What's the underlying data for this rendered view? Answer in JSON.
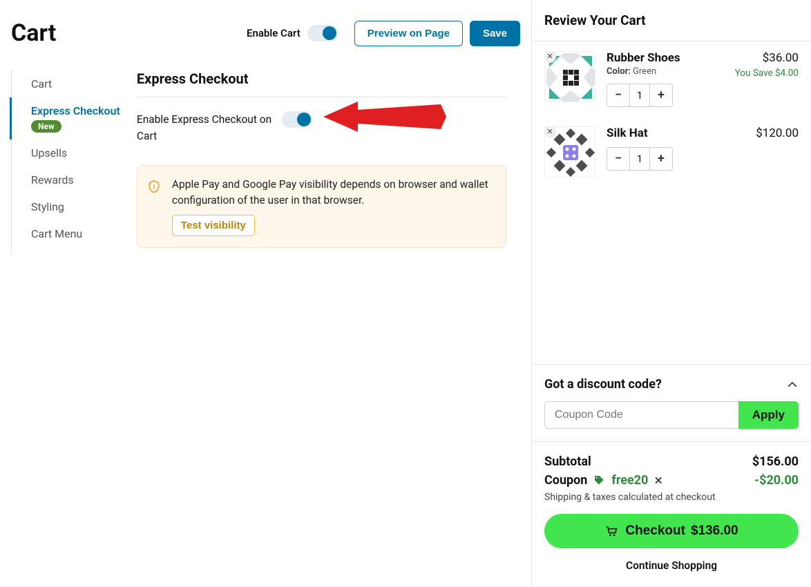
{
  "header": {
    "title": "Cart",
    "enable_label": "Enable Cart",
    "preview_label": "Preview on Page",
    "save_label": "Save"
  },
  "sidebar": {
    "items": [
      {
        "label": "Cart"
      },
      {
        "label": "Express Checkout",
        "badge": "New"
      },
      {
        "label": "Upsells"
      },
      {
        "label": "Rewards"
      },
      {
        "label": "Styling"
      },
      {
        "label": "Cart Menu"
      }
    ]
  },
  "section": {
    "title": "Express Checkout",
    "setting_label": "Enable Express Checkout on Cart",
    "callout_msg": "Apple Pay and Google Pay visibility depends on browser and wallet configuration of the user in that browser.",
    "test_label": "Test visibility"
  },
  "cart": {
    "review_title": "Review Your Cart",
    "items": [
      {
        "name": "Rubber Shoes",
        "meta_key": "Color:",
        "meta_val": "Green",
        "price": "$36.00",
        "save": "You Save $4.00",
        "qty": "1"
      },
      {
        "name": "Silk Hat",
        "price": "$120.00",
        "qty": "1"
      }
    ],
    "discount_title": "Got a discount code?",
    "coupon_placeholder": "Coupon Code",
    "apply_label": "Apply",
    "subtotal_label": "Subtotal",
    "subtotal_value": "$156.00",
    "coupon_label": "Coupon",
    "coupon_code": "free20",
    "coupon_value": "-$20.00",
    "shipping_note": "Shipping & taxes calculated at checkout",
    "checkout_label": "Checkout",
    "checkout_total": "$136.00",
    "continue_label": "Continue Shopping"
  }
}
